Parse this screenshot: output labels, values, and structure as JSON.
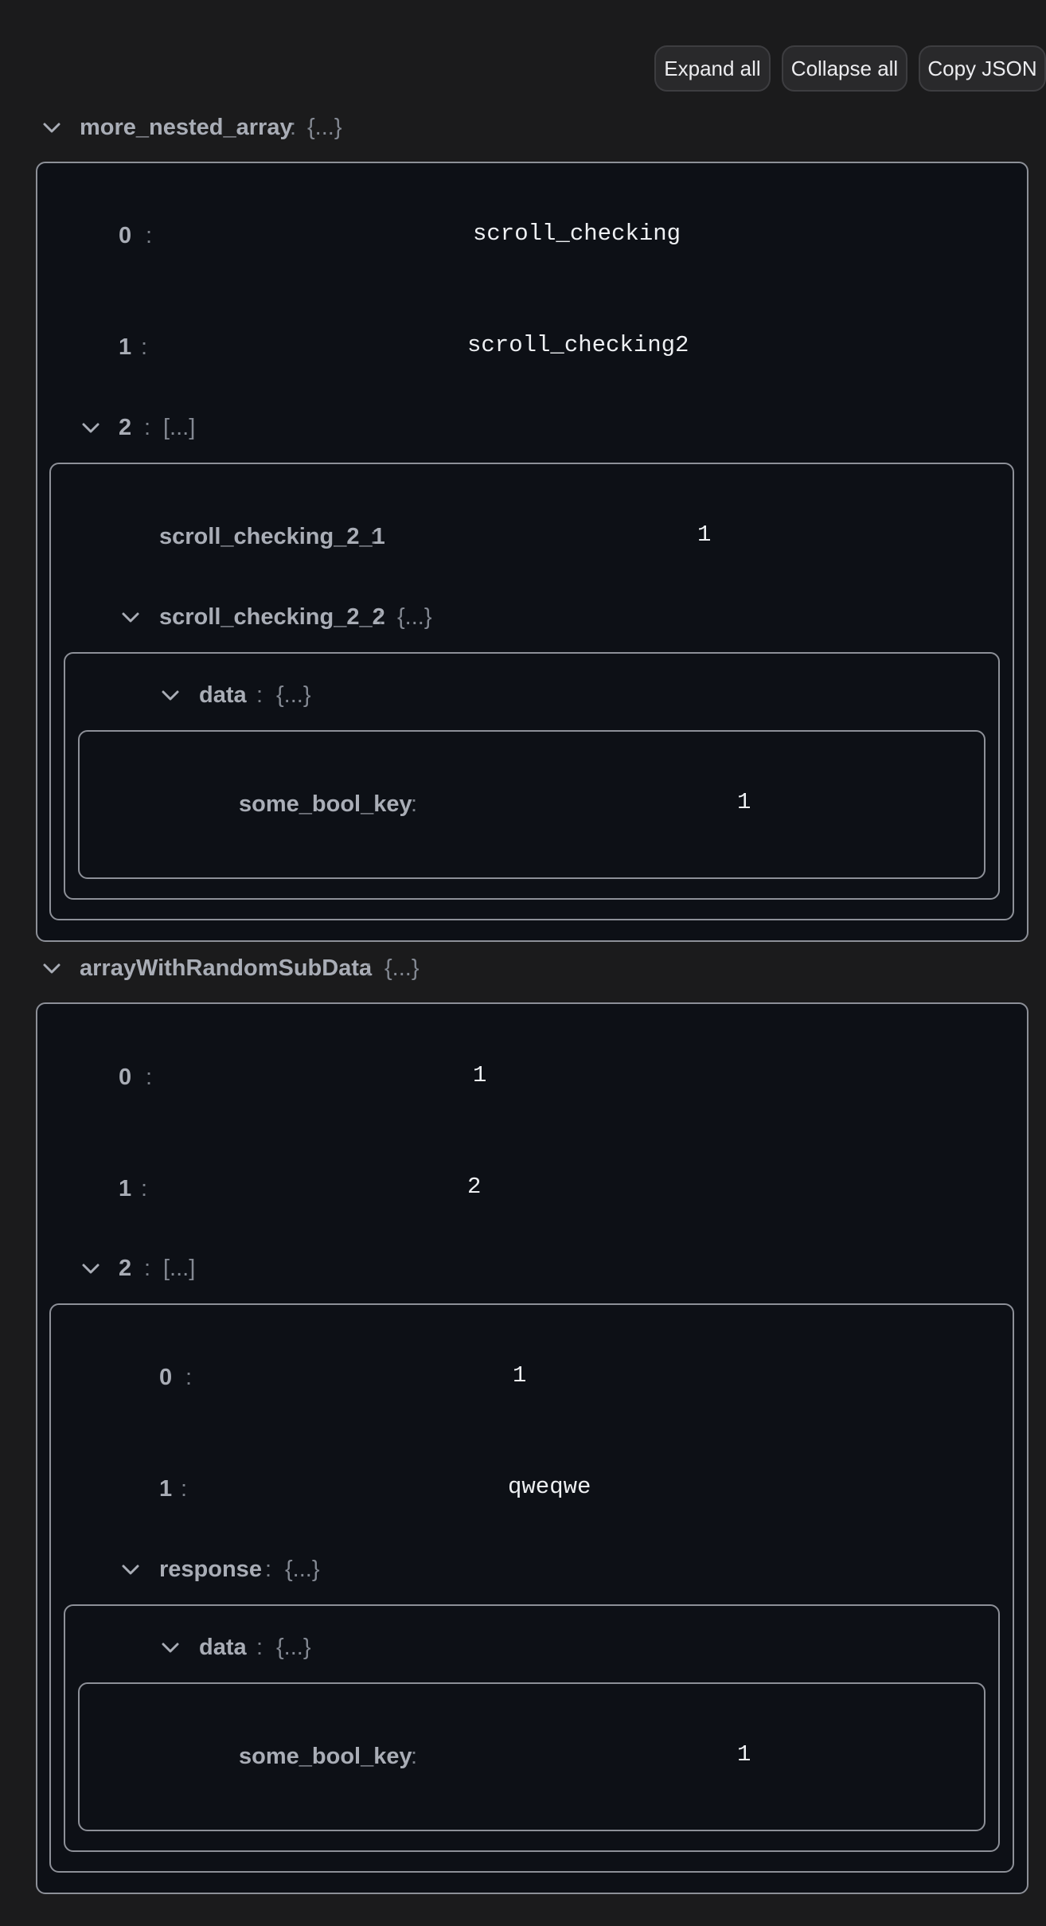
{
  "toolbar": {
    "expand_all": "Expand all",
    "collapse_all": "Collapse all",
    "copy_json": "Copy JSON"
  },
  "icons": {
    "toggle": "chevron-down-icon"
  },
  "tree": {
    "colon": ":",
    "obj_marker": "{...}",
    "arr_marker": "[...]",
    "more_nested_array": {
      "key": "more_nested_array",
      "i0": {
        "key": "0",
        "value": "scroll_checking"
      },
      "i1": {
        "key": "1",
        "value": "scroll_checking2"
      },
      "i2": {
        "key": "2",
        "sc21": {
          "key": "scroll_checking_2_1",
          "value": "1"
        },
        "sc22": {
          "key": "scroll_checking_2_2",
          "data": {
            "key": "data",
            "bool": {
              "key": "some_bool_key",
              "value": "1"
            }
          }
        }
      }
    },
    "arrayWithRandomSubData": {
      "key": "arrayWithRandomSubData",
      "i0": {
        "key": "0",
        "value": "1"
      },
      "i1": {
        "key": "1",
        "value": "2"
      },
      "i2": {
        "key": "2",
        "s0": {
          "key": "0",
          "value": "1"
        },
        "s1": {
          "key": "1",
          "value": "qweqwe"
        },
        "response": {
          "key": "response",
          "data": {
            "key": "data",
            "bool": {
              "key": "some_bool_key",
              "value": "1"
            }
          }
        }
      }
    }
  }
}
